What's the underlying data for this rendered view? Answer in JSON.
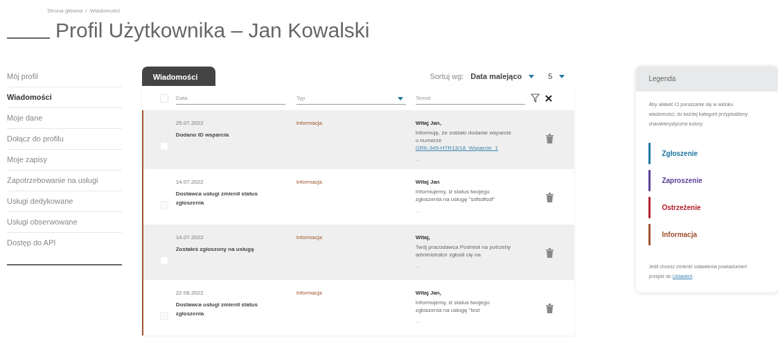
{
  "breadcrumb": {
    "items": [
      "Strona główna",
      "Wiadomości"
    ],
    "separator": "/"
  },
  "title": "Profil Użytkownika – Jan Kowalski",
  "sidebar": {
    "items": [
      {
        "label": "Mój profil",
        "selected": false
      },
      {
        "label": "Wiadomości",
        "selected": true
      },
      {
        "label": "Moje dane",
        "selected": false
      },
      {
        "label": "Dołącz do profilu",
        "selected": false
      },
      {
        "label": "Moje zapisy",
        "selected": false
      },
      {
        "label": "Zapotrzebowanie na usługi",
        "selected": false
      },
      {
        "label": "Usługi dedykowane",
        "selected": false
      },
      {
        "label": "Usługi obserwowane",
        "selected": false
      },
      {
        "label": "Dostęp do API",
        "selected": false
      }
    ]
  },
  "messages": {
    "tab": "Wiadomości",
    "sort_label": "Sortuj wg:",
    "sort_value": "Data malejąco",
    "page_size": "5",
    "select_all": {
      "checked": false
    },
    "filters": {
      "date": {
        "placeholder": "Data"
      },
      "type": {
        "placeholder": "Typ"
      },
      "subject": {
        "placeholder": "Temat"
      }
    },
    "rows": [
      {
        "date": "25.07.2022",
        "title": "Dodano ID wsparcia",
        "type": "Informacja",
        "color": "#a0522d",
        "unread": true,
        "greeting": "Witaj Jan,",
        "body": "Informuję, że zostało dodanie wsparcie o numerze ",
        "link": "GRK-345-HTR13/18_Wsparcie_1",
        "more": "..."
      },
      {
        "date": "14.07.2022",
        "title": "Dostawca usługi zmienił status zgłoszenia",
        "type": "Informacja",
        "color": "#a0522d",
        "unread": false,
        "greeting": "Witaj Jan",
        "body": "Informujemy, iż status twojego zgłoszenia na usługę \"sdfsdfsdf\"",
        "more": "..."
      },
      {
        "date": "14.07.2022",
        "title": "Zostałeś zgłoszony na usługę",
        "type": "Informacja",
        "color": "#a0522d",
        "unread": true,
        "greeting": "Witaj,",
        "body": "Twój pracodawca Podmiot na potrzeby administrator zgłosił cię na",
        "more": "..."
      },
      {
        "date": "22.06.2022",
        "title": "Dostawca usługi zmienił status zgłoszenia",
        "type": "Informacja",
        "color": "#a0522d",
        "unread": false,
        "greeting": "Witaj Jan,",
        "body": "Informujemy, iż status twojego zgłoszenia na usługę \"test",
        "more": "..."
      }
    ]
  },
  "legend": {
    "title": "Legenda",
    "intro": "Aby ułatwić Ci poruszanie się w widoku wiadomości, do każdej kategorii przypisaliśmy charakterystyczne kolory:",
    "categories": [
      {
        "label": "Zgłoszenie",
        "color": "#1f77a0"
      },
      {
        "label": "Zaproszenie",
        "color": "#5b3f95"
      },
      {
        "label": "Ostrzeżenie",
        "color": "#b5202e"
      },
      {
        "label": "Informacja",
        "color": "#a0522d"
      }
    ],
    "footer": "Jeśli chcesz zmienić ustawienia powiadomień przejdź do ",
    "footer_link": "Ustawień",
    "footer_end": "."
  }
}
